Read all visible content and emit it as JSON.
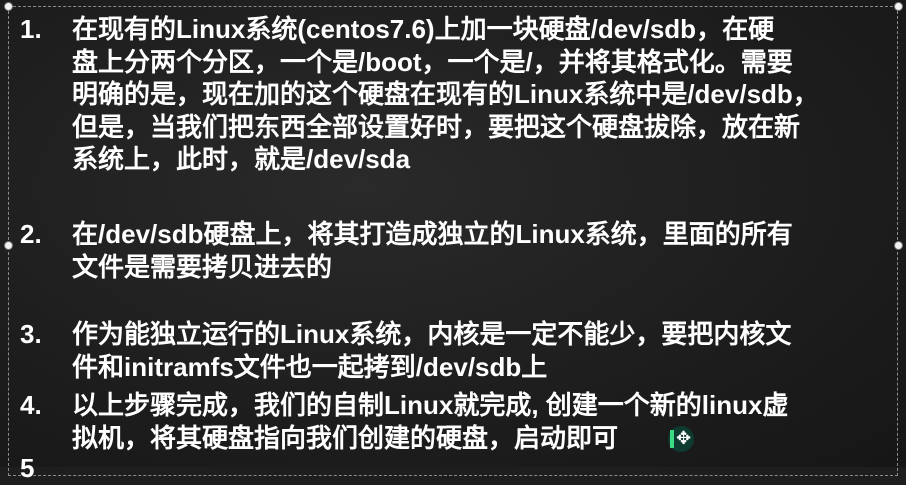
{
  "items": [
    {
      "num": "1.",
      "lines": [
        "在现有的Linux系统(centos7.6)上加一块硬盘/dev/sdb，在硬",
        "盘上分两个分区，一个是/boot，一个是/，并将其格式化。需要",
        "明确的是，现在加的这个硬盘在现有的Linux系统中是/dev/sdb，",
        "但是，当我们把东西全部设置好时，要把这个硬盘拔除，放在新",
        "系统上，此时，就是/dev/sda"
      ]
    },
    {
      "num": "2.",
      "lines": [
        "在/dev/sdb硬盘上，将其打造成独立的Linux系统，里面的所有",
        "文件是需要拷贝进去的"
      ]
    },
    {
      "num": "3.",
      "lines": [
        "作为能独立运行的Linux系统，内核是一定不能少，要把内核文",
        "件和initramfs文件也一起拷到/dev/sdb上"
      ]
    },
    {
      "num": "4.",
      "lines": [
        "以上步骤完成，我们的自制Linux就完成, 创建一个新的linux虚",
        "拟机，将其硬盘指向我们创建的硬盘，启动即可"
      ]
    },
    {
      "num": "5",
      "lines": []
    }
  ],
  "colors": {
    "background": "#1e1e1e",
    "text": "#ffffff",
    "cursor_accent": "#3ddc84"
  },
  "icons": {
    "cursor": "move-cursor-icon"
  }
}
